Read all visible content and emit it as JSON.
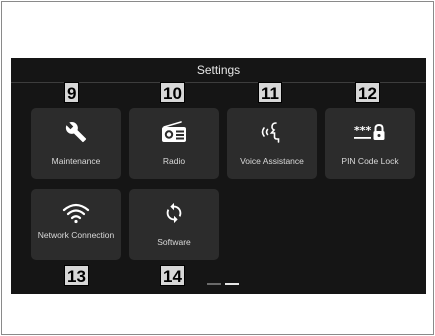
{
  "screen": {
    "title": "Settings",
    "tiles": [
      {
        "label": "Maintenance",
        "icon": "wrench-icon"
      },
      {
        "label": "Radio",
        "icon": "radio-icon"
      },
      {
        "label": "Voice Assistance",
        "icon": "voice-assistance-icon"
      },
      {
        "label": "PIN Code Lock",
        "icon": "pin-lock-icon"
      },
      {
        "label": "Network Connection",
        "icon": "wifi-icon"
      },
      {
        "label": "Software",
        "icon": "sync-icon"
      }
    ],
    "pager": {
      "pages": 2,
      "active": 2
    }
  },
  "callouts": [
    "9",
    "10",
    "11",
    "12",
    "13",
    "14"
  ],
  "colors": {
    "screen_bg": "#151515",
    "tile_bg": "#2c2c2c",
    "text": "#d9d9d9",
    "callout_bg": "#d7d7d7"
  }
}
